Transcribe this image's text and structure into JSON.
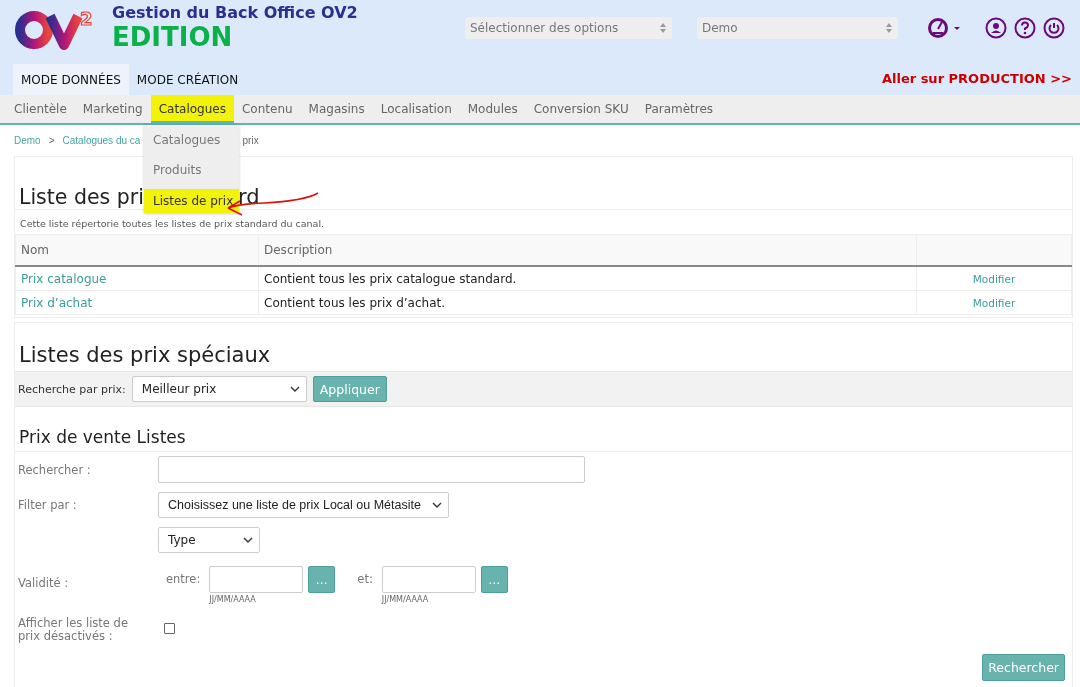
{
  "header": {
    "logo_mark": "2",
    "title": "Gestion du Back Office OV2",
    "subtitle": "EDITION",
    "selects": [
      {
        "placeholder": "Sélectionner des options"
      },
      {
        "value": "Demo"
      }
    ],
    "production_link": "Aller sur PRODUCTION >>"
  },
  "mode_tabs": [
    {
      "label": "MODE DONNÉES",
      "selected": true
    },
    {
      "label": "MODE CRÉATION",
      "selected": false
    }
  ],
  "nav": [
    {
      "label": "Clientèle",
      "selected": false,
      "highlighted": false
    },
    {
      "label": "Marketing",
      "selected": false,
      "highlighted": false
    },
    {
      "label": "Catalogues",
      "selected": true,
      "highlighted": true
    },
    {
      "label": "Contenu",
      "selected": false,
      "highlighted": false
    },
    {
      "label": "Magasins",
      "selected": false,
      "highlighted": false
    },
    {
      "label": "Localisation",
      "selected": false,
      "highlighted": false
    },
    {
      "label": "Modules",
      "selected": false,
      "highlighted": false
    },
    {
      "label": "Conversion SKU",
      "selected": false,
      "highlighted": false
    },
    {
      "label": "Paramètres",
      "selected": false,
      "highlighted": false
    }
  ],
  "nav_menu": [
    {
      "label": "Catalogues",
      "highlighted": false
    },
    {
      "label": "Produits",
      "highlighted": false
    },
    {
      "label": "Listes de prix",
      "highlighted": true
    }
  ],
  "breadcrumb": {
    "items": [
      "Demo",
      "Catalogues du ca"
    ],
    "separator": ">",
    "tail": "prix"
  },
  "standard": {
    "title_start": "Liste des pri",
    "title_end": "rd",
    "description": "Cette liste répertorie toutes les listes de prix standard du canal.",
    "columns": [
      "Nom",
      "Description"
    ],
    "rows": [
      {
        "name": "Prix catalogue",
        "description": "Contient tous les prix catalogue standard.",
        "action": "Modifier"
      },
      {
        "name": "Prix d’achat",
        "description": "Contient tous les prix d’achat.",
        "action": "Modifier"
      }
    ]
  },
  "special": {
    "title": "Listes des prix spéciaux",
    "filter_label": "Recherche par prix:",
    "filter_value": "Meilleur prix",
    "apply": "Appliquer",
    "section_title": "Prix de vente Listes",
    "search_label": "Rechercher :",
    "filter_by_label": "Filter par :",
    "list_select": "Choisissez une liste de prix Local ou Métasite",
    "type_select": "Type",
    "validity_label": "Validité :",
    "from_label": "entre:",
    "from_button": "...",
    "from_hint": "JJ/MM/AAAA",
    "to_label": "et:",
    "to_button": "...",
    "to_hint": "JJ/MM/AAAA",
    "inactive_label": "Afficher les liste de prix désactivés :",
    "inactive_checked": false,
    "submit": "Rechercher"
  }
}
